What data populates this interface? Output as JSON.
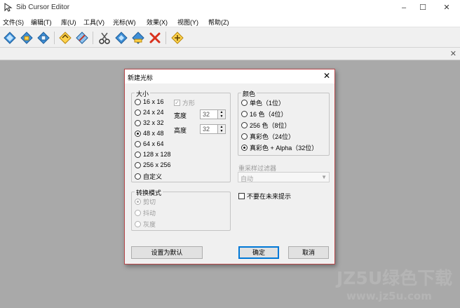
{
  "window": {
    "title": "Sib Cursor Editor",
    "controls": {
      "minimize": "–",
      "maximize": "☐",
      "close": "✕"
    }
  },
  "menu": [
    "文件(S)",
    "编辑(T)",
    "库(U)",
    "工具(V)",
    "光标(W)",
    "效果(X)",
    "视图(Y)",
    "帮助(Z)"
  ],
  "toolbar": {
    "buttons": [
      "new-icon",
      "open-icon",
      "save-icon",
      "library-icon",
      "edit-icon",
      "cut-icon",
      "copy-icon",
      "paste-icon",
      "delete-icon",
      "tool-icon"
    ]
  },
  "document": {
    "close_glyph": "✕"
  },
  "dialog": {
    "title": "新建光标",
    "close_glyph": "✕",
    "size_group": {
      "legend": "大小",
      "options": [
        "16 x 16",
        "24 x 24",
        "32 x 32",
        "48 x 48",
        "64 x 64",
        "128 x 128",
        "256 x 256",
        "自定义"
      ],
      "selected": "48 x 48",
      "square_label": "方形",
      "square_checked": true,
      "width_label": "宽度",
      "width_value": "32",
      "height_label": "高度",
      "height_value": "32"
    },
    "color_group": {
      "legend": "颜色",
      "options": [
        "单色（1位）",
        "16 色（4位）",
        "256 色（8位）",
        "真彩色（24位）",
        "真彩色 + Alpha（32位）"
      ],
      "selected": "真彩色 + Alpha（32位）"
    },
    "resample": {
      "label": "重采样过滤器",
      "value": "自动"
    },
    "convert_group": {
      "legend": "转换模式",
      "options": [
        "剪切",
        "抖动",
        "灰度"
      ],
      "selected": "剪切"
    },
    "dont_show_label": "不要在未来提示",
    "dont_show_checked": false,
    "buttons": {
      "set_default": "设置为默认",
      "ok": "确定",
      "cancel": "取消"
    }
  },
  "watermark": {
    "brand": "JZ5U绿色下载",
    "url": "www.jz5u.com"
  },
  "colors": {
    "dialog_border": "#b7474a",
    "workspace": "#a9a9a9",
    "accent": "#0078d7"
  }
}
